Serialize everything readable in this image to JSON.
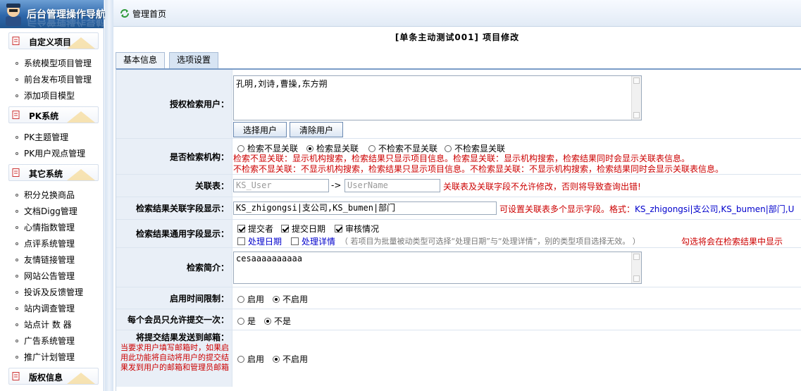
{
  "sidebar": {
    "banner_title": "后台管理操作导航",
    "sections": [
      {
        "title": "自定义项目",
        "items": [
          "系统模型项目管理",
          "前台发布项目管理",
          "添加项目模型"
        ]
      },
      {
        "title": "PK系统",
        "items": [
          "PK主题管理",
          "PK用户观点管理"
        ]
      },
      {
        "title": "其它系统",
        "items": [
          "积分兑换商品",
          "文档Digg管理",
          "心情指数管理",
          "点评系统管理",
          "友情链接管理",
          "网站公告管理",
          "投诉及反馈管理",
          "站内调查管理",
          "站点计 数 器",
          "广告系统管理",
          "推广计划管理"
        ]
      },
      {
        "title": "版权信息",
        "items": []
      }
    ]
  },
  "topbar": {
    "home_label": "管理首页"
  },
  "page_title": "[单条主动测试001] 项目修改",
  "tabs": [
    "基本信息",
    "选项设置"
  ],
  "active_tab": 1,
  "form": {
    "auth_users": {
      "label": "授权检索用户：",
      "value": "孔明,刘诗,曹操,东方朔",
      "select_btn": "选择用户",
      "clear_btn": "清除用户"
    },
    "search_org": {
      "label": "是否检索机构：",
      "options": [
        "检索不显关联",
        "检索显关联",
        "不检索不显关联",
        "不检索显关联"
      ],
      "selected": 1,
      "help_line1": "检索不显关联：显示机构搜索，检索结果只显示项目信息。检索显关联：显示机构搜索，检索结果同时会显示关联表信息。",
      "help_line2": "不检索不显关联：不显示机构搜索，检索结果只显示项目信息。不检索显关联：不显示机构搜索，检索结果同时会显示关联表信息。"
    },
    "relation": {
      "label": "关联表：",
      "table_placeholder": "KS_User",
      "arrow": "->",
      "field_placeholder": "UserName",
      "warning": "关联表及关联字段不允许修改，否则将导致查询出错!"
    },
    "result_fields": {
      "label": "检索结果关联字段显示：",
      "value": "KS_zhigongsi|支公司,KS_bumen|部门",
      "hint_prefix": "可设置关联表多个显示字段。格式：",
      "hint_example": "KS_zhigongsi|支公司,KS_bumen|部门,U"
    },
    "common_fields": {
      "label": "检索结果通用字段显示：",
      "checks": [
        {
          "text": "提交者",
          "checked": true
        },
        {
          "text": "提交日期",
          "checked": true
        },
        {
          "text": "审核情况",
          "checked": true
        }
      ],
      "checks2": [
        {
          "text": "处理日期",
          "checked": false
        },
        {
          "text": "处理详情",
          "checked": false
        }
      ],
      "note_grey": "（ 若项目为批量被动类型可选择“处理日期”与“处理详情”，别的类型项目选择无效。 ）",
      "note_red": "勾选将会在检索结果中显示"
    },
    "intro": {
      "label": "检索简介：",
      "value": "cesaaaaaaaaaa"
    },
    "time_limit": {
      "label": "启用时间限制：",
      "options": [
        "启用",
        "不启用"
      ],
      "selected": 1
    },
    "once_per_member": {
      "label": "每个会员只允许提交一次：",
      "options": [
        "是",
        "不是"
      ],
      "selected": 1
    },
    "email_send": {
      "label": "将提交结果发送到邮箱：",
      "help": "当要求用户填写邮箱时，如果启用此功能将自动将用户的提交结果发到用户的邮箱和管理员邮箱",
      "options": [
        "启用",
        "不启用"
      ],
      "selected": 1
    }
  }
}
